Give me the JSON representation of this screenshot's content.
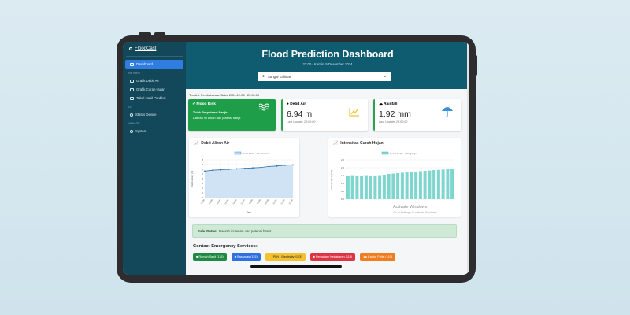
{
  "sidebar": {
    "brand": "FloodCast",
    "items": [
      {
        "label": "Dashboard",
        "active": true,
        "icon": "dashboard-icon"
      },
      {
        "section": "HISTORY"
      },
      {
        "label": "Grafik Debit Air",
        "icon": "chart-icon"
      },
      {
        "label": "Grafik Curah Hujan",
        "icon": "chart-icon"
      },
      {
        "label": "Tabel Hasil Prediksi",
        "icon": "table-icon"
      },
      {
        "section": "IOT"
      },
      {
        "label": "Status Device",
        "icon": "device-icon"
      },
      {
        "section": "MANAGE"
      },
      {
        "label": "System",
        "icon": "system-icon"
      }
    ]
  },
  "header": {
    "title": "Flood Prediction Dashboard",
    "subtitle": "23:00 - Kamis, 5 Desember 2024",
    "select_value": "Sungai Kalimas"
  },
  "last_updated": "Terakhir Pembaharuan Data: 2024-12-05 , 23:00:00",
  "cards": {
    "risk": {
      "title": "Flood Risk",
      "status": "Tidak Berpotensi Banjir",
      "desc": "Daerah ini aman dari potensi banjir."
    },
    "debit": {
      "title": "Debit Air",
      "value": "6.94 m",
      "updated": "Last Update: 23:00:00"
    },
    "rain": {
      "title": "Rainfall",
      "value": "1.92 mm",
      "updated": "Last Update: 23:00:00"
    }
  },
  "charts": {
    "debit": {
      "title": "Debit Aliran Air",
      "legend": "Debit Aliran - Piezometer",
      "xlabel": "Jam",
      "ylabel": "Debit Aliran (m)"
    },
    "rain": {
      "title": "Intensitas Curah Hujan",
      "legend": "Curah Hujan - Raingauge",
      "ylabel": "Curah Hujan (mm)"
    }
  },
  "chart_data": [
    {
      "type": "area",
      "title": "Debit Aliran Air",
      "xlabel": "Jam",
      "ylabel": "Debit Aliran (m)",
      "categories": [
        "12:00",
        "13:00",
        "14:00",
        "15:00",
        "16:00",
        "17:00",
        "18:00",
        "19:00",
        "20:00",
        "21:00",
        "22:00",
        "23:00"
      ],
      "series": [
        {
          "name": "Debit Aliran - Piezometer",
          "values": [
            5.6,
            5.8,
            5.9,
            6.0,
            6.1,
            6.2,
            6.3,
            6.4,
            6.6,
            6.7,
            6.85,
            6.94
          ]
        }
      ],
      "ylim": [
        0,
        8
      ],
      "yticks": [
        0,
        1,
        2,
        3,
        4,
        5,
        6,
        7,
        8
      ]
    },
    {
      "type": "bar",
      "title": "Intensitas Curah Hujan",
      "ylabel": "Curah Hujan (mm)",
      "series": [
        {
          "name": "Curah Hujan - Raingauge",
          "values": [
            1.5,
            1.52,
            1.5,
            1.5,
            1.52,
            1.5,
            1.5,
            1.52,
            1.55,
            1.6,
            1.62,
            1.65,
            1.68,
            1.7,
            1.72,
            1.75,
            1.78,
            1.8,
            1.82,
            1.85,
            1.86,
            1.88,
            1.9,
            1.92
          ]
        }
      ],
      "ylim": [
        0,
        2.5
      ],
      "yticks": [
        0,
        0.5,
        1.0,
        1.5,
        2.0,
        2.5
      ]
    }
  ],
  "safe_status": {
    "label": "Safe Status!",
    "text": "Daerah ini aman dari potensi banjir..."
  },
  "contacts": {
    "title": "Contact Emergency Services:",
    "items": [
      {
        "label": "Rumah Sakit (118)",
        "color": "#1f8a45"
      },
      {
        "label": "Basarnas (115)",
        "color": "#2f6fe0"
      },
      {
        "label": "PLN - Electricity (123)",
        "color": "#f2c230"
      },
      {
        "label": "Pemadam Kebakaran (113)",
        "color": "#dc3545"
      },
      {
        "label": "Kantor Polisi (110)",
        "color": "#f07d20"
      }
    ]
  },
  "watermark": {
    "line1": "Activate Windows",
    "line2": "Go to Settings to activate Windows."
  }
}
